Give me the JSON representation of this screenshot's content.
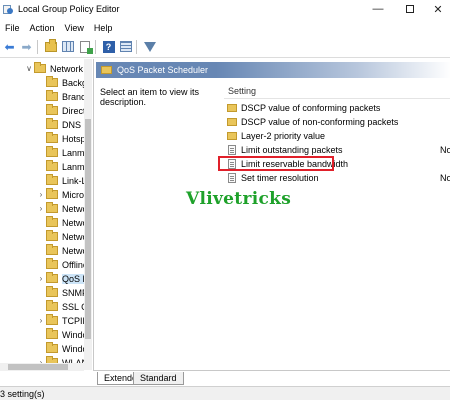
{
  "window": {
    "title": "Local Group Policy Editor",
    "minimize": "—",
    "close": "✕"
  },
  "menu": [
    "File",
    "Action",
    "View",
    "Help"
  ],
  "toolbar": {
    "icons": [
      "back-arrow-icon",
      "forward-arrow-icon",
      "up-folder-icon",
      "show-hide-tree-icon",
      "export-list-icon",
      "help-icon",
      "properties-icon",
      "filter-icon"
    ],
    "back": "⬅",
    "forward": "➡",
    "help": "?"
  },
  "tree": {
    "items": [
      {
        "label": "Network",
        "expander": "∨"
      },
      {
        "label": "Backgr",
        "expander": ""
      },
      {
        "label": "Branch",
        "expander": ""
      },
      {
        "label": "DirectA",
        "expander": ""
      },
      {
        "label": "DNS C",
        "expander": ""
      },
      {
        "label": "Hotspo",
        "expander": ""
      },
      {
        "label": "Lanma",
        "expander": ""
      },
      {
        "label": "Lanma",
        "expander": ""
      },
      {
        "label": "Link-La",
        "expander": ""
      },
      {
        "label": "Micros",
        "expander": "›"
      },
      {
        "label": "Netwo",
        "expander": "›"
      },
      {
        "label": "Netwo",
        "expander": ""
      },
      {
        "label": "Netwo",
        "expander": ""
      },
      {
        "label": "Netwo",
        "expander": ""
      },
      {
        "label": "Offline",
        "expander": ""
      },
      {
        "label": "QoS Pa",
        "expander": "›",
        "selected": true
      },
      {
        "label": "SNMP",
        "expander": ""
      },
      {
        "label": "SSL Co",
        "expander": ""
      },
      {
        "label": "TCPIP",
        "expander": "›"
      },
      {
        "label": "Windo",
        "expander": ""
      },
      {
        "label": "Windo",
        "expander": ""
      },
      {
        "label": "WLAN",
        "expander": "›"
      }
    ]
  },
  "main": {
    "header_title": "QoS Packet Scheduler",
    "description": "Select an item to view its description.",
    "column_setting": "Setting",
    "rows": [
      {
        "name": "DSCP value of conforming packets",
        "kind": "folder",
        "state": ""
      },
      {
        "name": "DSCP value of non-conforming packets",
        "kind": "folder",
        "state": ""
      },
      {
        "name": "Layer-2 priority value",
        "kind": "folder",
        "state": ""
      },
      {
        "name": "Limit outstanding packets",
        "kind": "policy",
        "state": "Not"
      },
      {
        "name": "Limit reservable bandwidth",
        "kind": "policy",
        "state": ""
      },
      {
        "name": "Set timer resolution",
        "kind": "policy",
        "state": "Not"
      }
    ]
  },
  "watermark": "Vlivetricks",
  "tabs": [
    "Extended",
    "Standard"
  ],
  "status": "3 setting(s)",
  "colors": {
    "header_bg": "#6787b4",
    "highlight_border": "#e0202a",
    "watermark": "#1ea12a",
    "selected_bg": "#cce4f7"
  }
}
